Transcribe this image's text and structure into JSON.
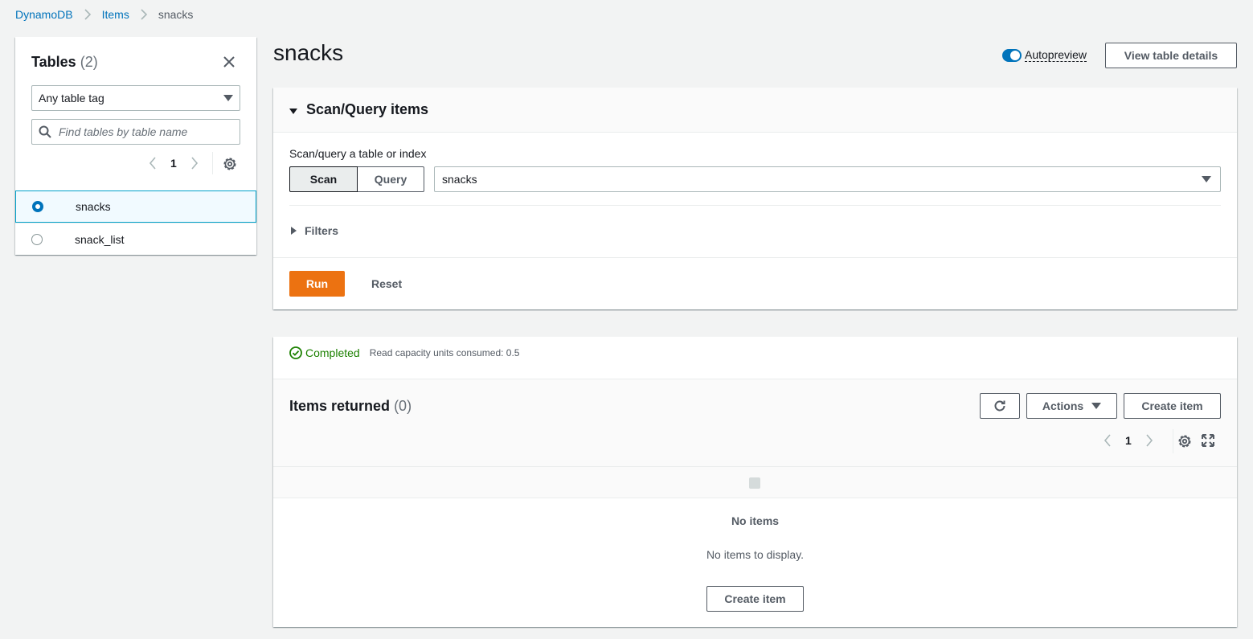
{
  "breadcrumb": {
    "items": [
      {
        "label": "DynamoDB"
      },
      {
        "label": "Items"
      },
      {
        "label": "snacks"
      }
    ]
  },
  "left_panel": {
    "title": "Tables",
    "count": "(2)",
    "tag_filter": {
      "selected": "Any table tag"
    },
    "search": {
      "placeholder": "Find tables by table name",
      "value": ""
    },
    "pagination": {
      "page": "1"
    },
    "tables": [
      {
        "name": "snacks",
        "selected": true
      },
      {
        "name": "snack_list",
        "selected": false
      }
    ]
  },
  "header": {
    "title": "snacks",
    "autopreview": {
      "label": "Autopreview",
      "enabled": true
    },
    "view_details_label": "View table details"
  },
  "scan_panel": {
    "title": "Scan/Query items",
    "field_label": "Scan/query a table or index",
    "mode_options": [
      {
        "label": "Scan",
        "active": true
      },
      {
        "label": "Query",
        "active": false
      }
    ],
    "table_select": {
      "selected": "snacks"
    },
    "filters_label": "Filters",
    "run_label": "Run",
    "reset_label": "Reset"
  },
  "results": {
    "status": "Completed",
    "meta": "Read capacity units consumed: 0.5",
    "title": "Items returned",
    "count": "(0)",
    "actions_label": "Actions",
    "create_item_label": "Create item",
    "pagination": {
      "page": "1"
    },
    "empty_title": "No items",
    "empty_description": "No items to display.",
    "empty_create_label": "Create item"
  },
  "colors": {
    "link": "#0073bb",
    "primary_button": "#ec7211",
    "success": "#1d8102",
    "selected_row_border": "#00a1c9"
  }
}
